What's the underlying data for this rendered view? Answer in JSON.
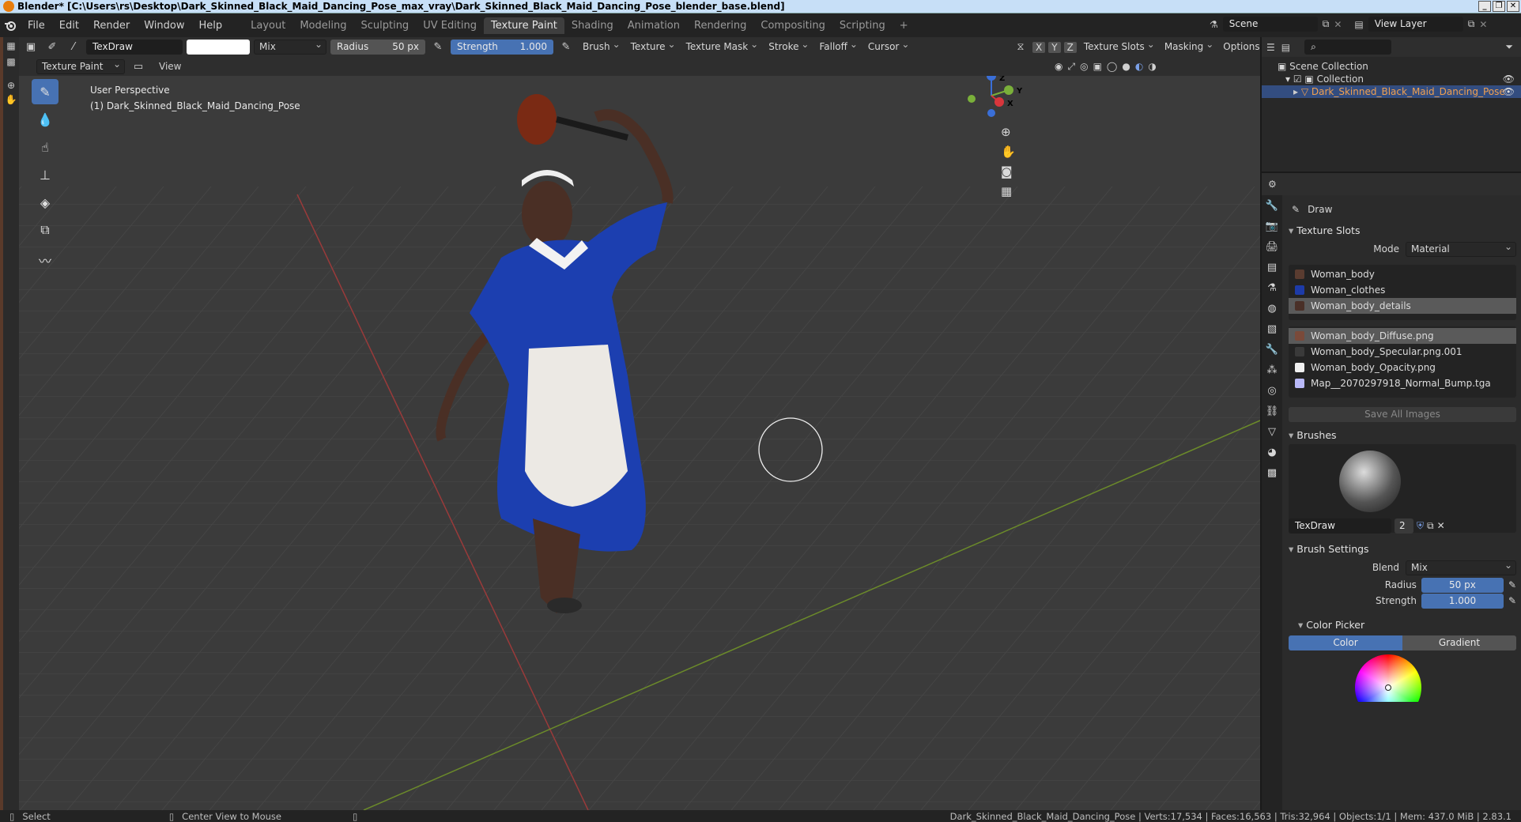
{
  "window": {
    "title": "Blender* [C:\\Users\\rs\\Desktop\\Dark_Skinned_Black_Maid_Dancing_Pose_max_vray\\Dark_Skinned_Black_Maid_Dancing_Pose_blender_base.blend]",
    "controls": [
      "_",
      "❐",
      "✕"
    ]
  },
  "menubar": {
    "items": [
      "File",
      "Edit",
      "Render",
      "Window",
      "Help"
    ],
    "workspaces": [
      "Layout",
      "Modeling",
      "Sculpting",
      "UV Editing",
      "Texture Paint",
      "Shading",
      "Animation",
      "Rendering",
      "Compositing",
      "Scripting"
    ],
    "active_workspace": "Texture Paint",
    "add_tab": "+",
    "scene": "Scene",
    "view_layer": "View Layer"
  },
  "tool_header": {
    "brush_name": "TexDraw",
    "color_hex": "#ffffff",
    "blend": "Mix",
    "radius_label": "Radius",
    "radius_value": "50 px",
    "strength_label": "Strength",
    "strength_value": "1.000",
    "menus": [
      "Brush",
      "Texture",
      "Texture Mask",
      "Stroke",
      "Falloff",
      "Cursor"
    ],
    "axes": [
      "X",
      "Y",
      "Z"
    ],
    "right_menus": [
      "Texture Slots",
      "Masking",
      "Options"
    ]
  },
  "viewport_header": {
    "mode": "Texture Paint",
    "view": "View"
  },
  "viewport": {
    "perspective": "User Perspective",
    "object": "(1) Dark_Skinned_Black_Maid_Dancing_Pose",
    "gizmo_axes": [
      "X",
      "Y",
      "Z"
    ]
  },
  "outliner": {
    "root": "Scene Collection",
    "collection": "Collection",
    "object": "Dark_Skinned_Black_Maid_Dancing_Pose"
  },
  "properties": {
    "tool_name": "Draw",
    "texture_slots": {
      "title": "Texture Slots",
      "mode_label": "Mode",
      "mode_value": "Material",
      "materials": [
        {
          "name": "Woman_body",
          "color": "#5a3c30"
        },
        {
          "name": "Woman_clothes",
          "color": "#1d3ba8"
        },
        {
          "name": "Woman_body_details",
          "color": "#4a3028"
        }
      ],
      "images": [
        {
          "name": "Woman_body_Diffuse.png",
          "color": "#7a4a3a"
        },
        {
          "name": "Woman_body_Specular.png.001",
          "color": "#3a3a3a"
        },
        {
          "name": "Woman_body_Opacity.png",
          "color": "#f0f0f0"
        },
        {
          "name": "Map__2070297918_Normal_Bump.tga",
          "color": "#b8b8f8"
        }
      ],
      "save_all": "Save All Images"
    },
    "brushes": {
      "title": "Brushes",
      "brush_name": "TexDraw",
      "users": "2"
    },
    "brush_settings": {
      "title": "Brush Settings",
      "blend_label": "Blend",
      "blend_value": "Mix",
      "radius_label": "Radius",
      "radius_value": "50 px",
      "strength_label": "Strength",
      "strength_value": "1.000"
    },
    "color_picker": {
      "title": "Color Picker",
      "tabs": [
        "Color",
        "Gradient"
      ]
    }
  },
  "statusbar": {
    "select": "Select",
    "center": "Center View to Mouse",
    "stats": "Dark_Skinned_Black_Maid_Dancing_Pose | Verts:17,534 | Faces:16,563 | Tris:32,964 | Objects:1/1 | Mem: 437.0 MiB | 2.83.1"
  }
}
